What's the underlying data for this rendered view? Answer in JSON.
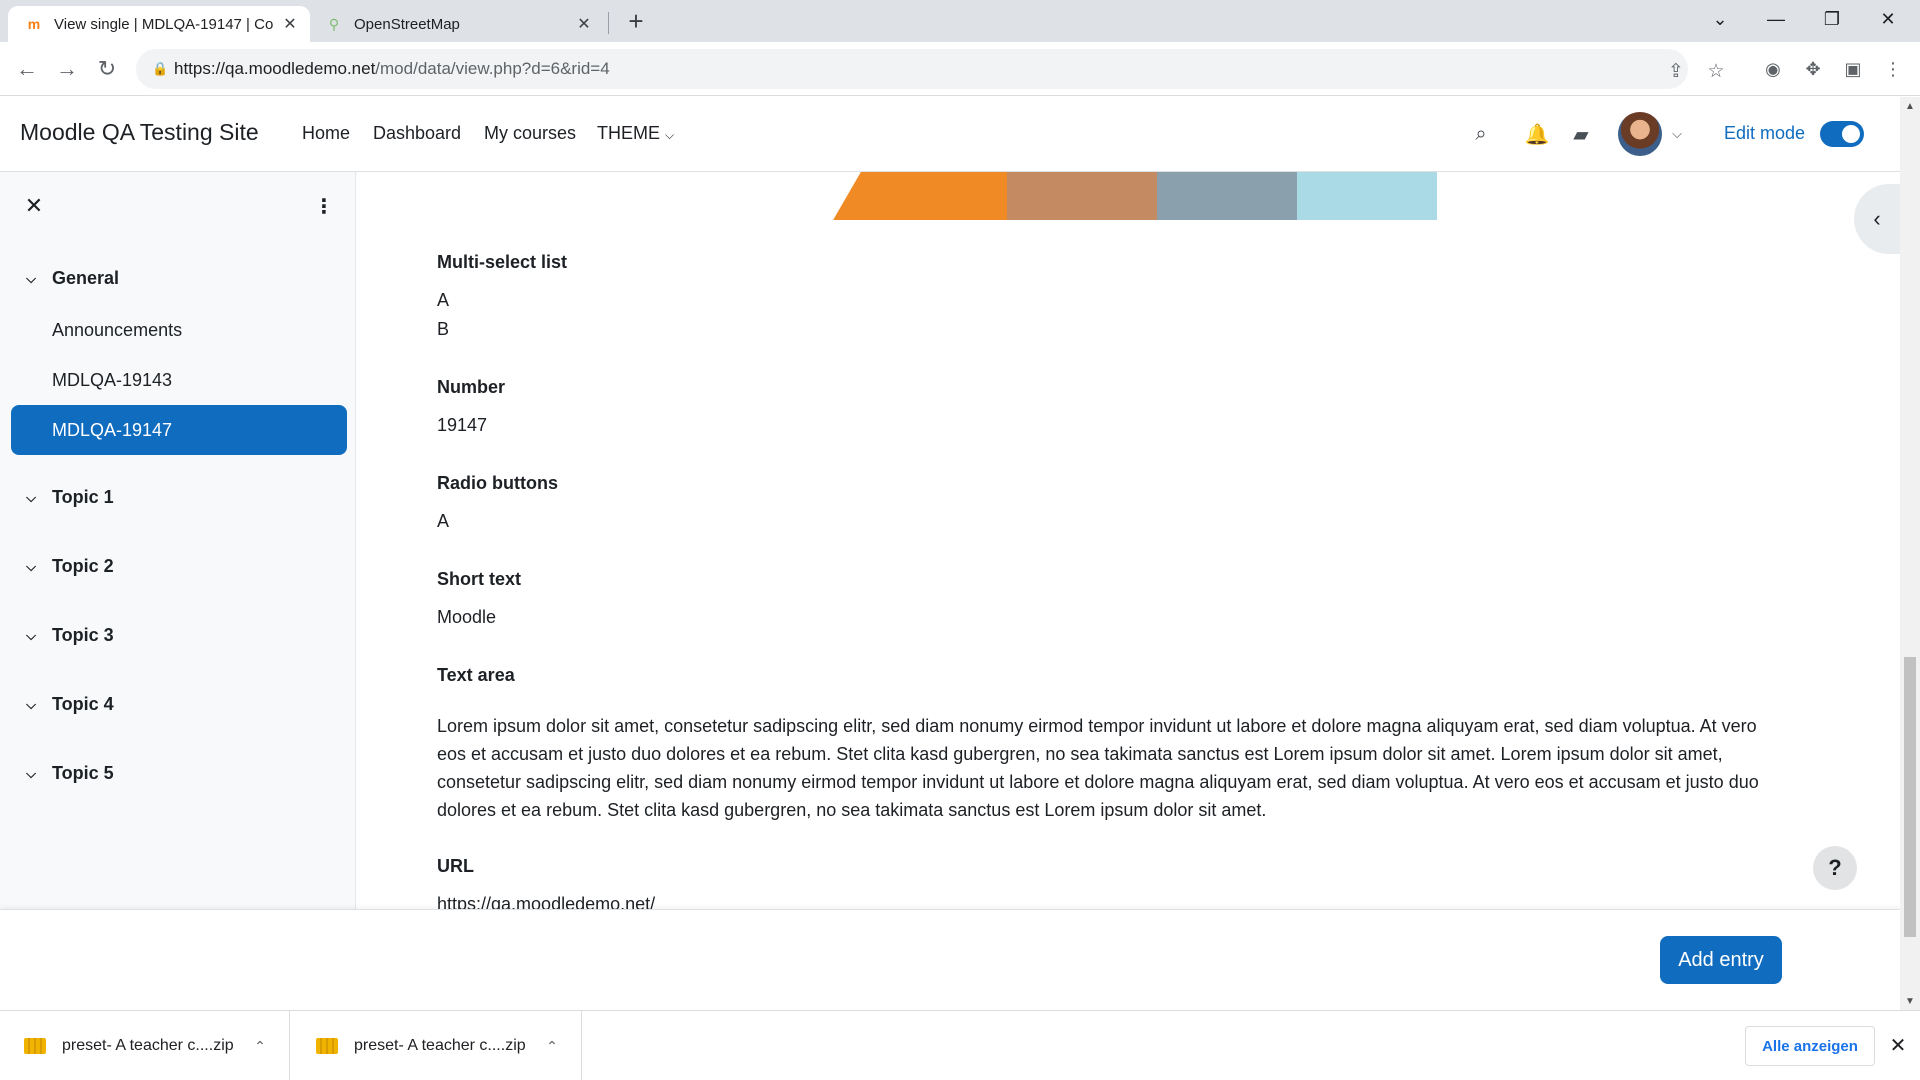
{
  "browser": {
    "tabs": [
      {
        "title": "View single | MDLQA-19147 | Co",
        "favicon": "moodle-icon",
        "active": true
      },
      {
        "title": "OpenStreetMap",
        "favicon": "magnifier-icon",
        "active": false
      }
    ],
    "url_host": "https://qa.moodledemo.net",
    "url_path": "/mod/data/view.php?d=6&rid=4"
  },
  "navbar": {
    "brand": "Moodle QA Testing Site",
    "menu": [
      "Home",
      "Dashboard",
      "My courses",
      "THEME"
    ],
    "edit_mode_label": "Edit mode",
    "edit_mode_on": true
  },
  "drawer": {
    "sections": [
      {
        "title": "General",
        "items": [
          "Announcements",
          "MDLQA-19143",
          "MDLQA-19147"
        ],
        "active_item": "MDLQA-19147"
      },
      {
        "title": "Topic 1"
      },
      {
        "title": "Topic 2"
      },
      {
        "title": "Topic 3"
      },
      {
        "title": "Topic 4"
      },
      {
        "title": "Topic 5"
      }
    ]
  },
  "entry": {
    "fields": [
      {
        "label": "Multi-select list",
        "values": [
          "A",
          "B"
        ]
      },
      {
        "label": "Number",
        "values": [
          "19147"
        ]
      },
      {
        "label": "Radio buttons",
        "values": [
          "A"
        ]
      },
      {
        "label": "Short text",
        "values": [
          "Moodle"
        ]
      },
      {
        "label": "Text area",
        "values": [
          "Lorem ipsum dolor sit amet, consetetur sadipscing elitr, sed diam nonumy eirmod tempor invidunt ut labore et dolore magna aliquyam erat, sed diam voluptua. At vero eos et accusam et justo duo dolores et ea rebum. Stet clita kasd gubergren, no sea takimata sanctus est Lorem ipsum dolor sit amet. Lorem ipsum dolor sit amet, consetetur sadipscing elitr, sed diam nonumy eirmod tempor invidunt ut labore et dolore magna aliquyam erat, sed diam voluptua. At vero eos et accusam et justo duo dolores et ea rebum. Stet clita kasd gubergren, no sea takimata sanctus est Lorem ipsum dolor sit amet."
        ]
      },
      {
        "label": "URL",
        "values": [
          "https://qa.moodledemo.net/"
        ]
      }
    ]
  },
  "footer": {
    "add_entry": "Add entry",
    "help": "?"
  },
  "downloads": {
    "items": [
      "preset- A teacher c....zip",
      "preset- A teacher c....zip"
    ],
    "show_all": "Alle anzeigen"
  },
  "colors": {
    "primary": "#0f6cbf",
    "drawer_bg": "#f8f9fa"
  }
}
